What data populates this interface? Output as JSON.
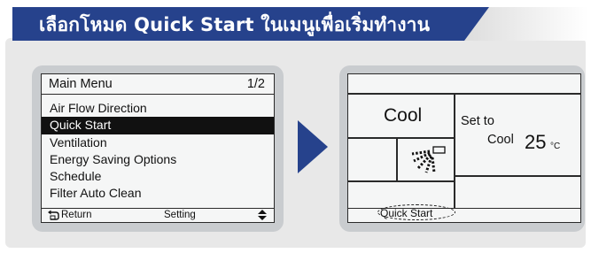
{
  "banner": {
    "title": "เลือกโหมด Quick Start ในเมนูเพื่อเริ่มทำงาน",
    "color": "#26428c"
  },
  "menu_screen": {
    "title": "Main Menu",
    "page": "1/2",
    "items": [
      {
        "label": "Air Flow Direction",
        "selected": false
      },
      {
        "label": "Quick Start",
        "selected": true
      },
      {
        "label": "Ventilation",
        "selected": false
      },
      {
        "label": "Energy Saving Options",
        "selected": false
      },
      {
        "label": "Schedule",
        "selected": false
      },
      {
        "label": "Filter Auto Clean",
        "selected": false
      }
    ],
    "footer": {
      "return_label": "Return",
      "return_icon": "return-icon",
      "setting_label": "Setting",
      "scroll_icon": "up-down-arrows-icon"
    }
  },
  "next_arrow": {
    "icon": "chevron-right-icon",
    "color": "#26428c"
  },
  "status_screen": {
    "mode": "Cool",
    "set_to_label": "Set to",
    "set_mode": "Cool",
    "set_temp": "25",
    "set_unit": "°C",
    "fan_icon": "airflow-icon",
    "quick_start_label": "Quick Start"
  }
}
